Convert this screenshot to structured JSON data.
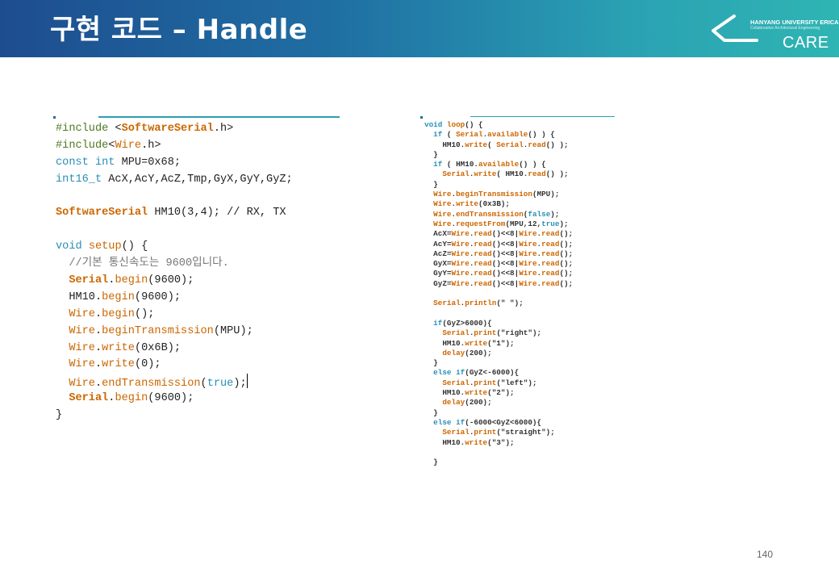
{
  "slide": {
    "title": "구현 코드 – Handle",
    "page_number": "140"
  },
  "logo": {
    "university": "HANYANG UNIVERSITY ERICA",
    "subtitle": "Collaborative Architectural Engineering",
    "brand": "CARE"
  },
  "left_code": {
    "lines": [
      [
        {
          "t": "#include ",
          "c": "pp"
        },
        {
          "t": "<",
          "c": ""
        },
        {
          "t": "SoftwareSerial",
          "c": "tyb"
        },
        {
          "t": ".h>",
          "c": ""
        }
      ],
      [
        {
          "t": "#include",
          "c": "pp"
        },
        {
          "t": "<",
          "c": ""
        },
        {
          "t": "Wire",
          "c": "ty"
        },
        {
          "t": ".h>",
          "c": ""
        }
      ],
      [
        {
          "t": "const",
          "c": "kw"
        },
        {
          "t": " ",
          "c": ""
        },
        {
          "t": "int",
          "c": "kw"
        },
        {
          "t": " MPU=0x68;",
          "c": ""
        }
      ],
      [
        {
          "t": "int16_t",
          "c": "kw"
        },
        {
          "t": " AcX,AcY,AcZ,Tmp,GyX,GyY,GyZ;",
          "c": ""
        }
      ],
      [],
      [
        {
          "t": "SoftwareSerial",
          "c": "tyb"
        },
        {
          "t": " HM10(3,4); // RX, TX",
          "c": ""
        }
      ],
      [],
      [
        {
          "t": "void",
          "c": "kw"
        },
        {
          "t": " ",
          "c": ""
        },
        {
          "t": "setup",
          "c": "ty"
        },
        {
          "t": "() {",
          "c": ""
        }
      ],
      [
        {
          "t": "  //기본 통신속도는 9600입니다.",
          "c": "cm"
        }
      ],
      [
        {
          "t": "  ",
          "c": ""
        },
        {
          "t": "Serial",
          "c": "tyb"
        },
        {
          "t": ".",
          "c": ""
        },
        {
          "t": "begin",
          "c": "fn"
        },
        {
          "t": "(9600);",
          "c": ""
        }
      ],
      [
        {
          "t": "  HM10.",
          "c": ""
        },
        {
          "t": "begin",
          "c": "fn"
        },
        {
          "t": "(9600);",
          "c": ""
        }
      ],
      [
        {
          "t": "  ",
          "c": ""
        },
        {
          "t": "Wire",
          "c": "ty"
        },
        {
          "t": ".",
          "c": ""
        },
        {
          "t": "begin",
          "c": "fn"
        },
        {
          "t": "();",
          "c": ""
        }
      ],
      [
        {
          "t": "  ",
          "c": ""
        },
        {
          "t": "Wire",
          "c": "ty"
        },
        {
          "t": ".",
          "c": ""
        },
        {
          "t": "beginTransmission",
          "c": "fn"
        },
        {
          "t": "(MPU);",
          "c": ""
        }
      ],
      [
        {
          "t": "  ",
          "c": ""
        },
        {
          "t": "Wire",
          "c": "ty"
        },
        {
          "t": ".",
          "c": ""
        },
        {
          "t": "write",
          "c": "fn"
        },
        {
          "t": "(0x6B);",
          "c": ""
        }
      ],
      [
        {
          "t": "  ",
          "c": ""
        },
        {
          "t": "Wire",
          "c": "ty"
        },
        {
          "t": ".",
          "c": ""
        },
        {
          "t": "write",
          "c": "fn"
        },
        {
          "t": "(0);",
          "c": ""
        }
      ],
      [
        {
          "t": "  ",
          "c": ""
        },
        {
          "t": "Wire",
          "c": "ty"
        },
        {
          "t": ".",
          "c": ""
        },
        {
          "t": "endTransmission",
          "c": "fn"
        },
        {
          "t": "(",
          "c": ""
        },
        {
          "t": "true",
          "c": "kw"
        },
        {
          "t": ");",
          "c": ""
        },
        {
          "t": "",
          "c": "cursor"
        }
      ],
      [
        {
          "t": "  ",
          "c": ""
        },
        {
          "t": "Serial",
          "c": "tyb"
        },
        {
          "t": ".",
          "c": ""
        },
        {
          "t": "begin",
          "c": "fn"
        },
        {
          "t": "(9600);",
          "c": ""
        }
      ],
      [
        {
          "t": "}",
          "c": ""
        }
      ]
    ]
  },
  "right_code": {
    "lines": [
      [
        {
          "t": "void",
          "c": "kw"
        },
        {
          "t": " ",
          "c": ""
        },
        {
          "t": "loop",
          "c": "ty"
        },
        {
          "t": "() {",
          "c": ""
        }
      ],
      [
        {
          "t": "  ",
          "c": ""
        },
        {
          "t": "if",
          "c": "kw"
        },
        {
          "t": " ( ",
          "c": ""
        },
        {
          "t": "Serial",
          "c": "ty"
        },
        {
          "t": ".",
          "c": ""
        },
        {
          "t": "available",
          "c": "fn"
        },
        {
          "t": "() ) {",
          "c": ""
        }
      ],
      [
        {
          "t": "    HM10.",
          "c": ""
        },
        {
          "t": "write",
          "c": "fn"
        },
        {
          "t": "( ",
          "c": ""
        },
        {
          "t": "Serial",
          "c": "ty"
        },
        {
          "t": ".",
          "c": ""
        },
        {
          "t": "read",
          "c": "fn"
        },
        {
          "t": "() );",
          "c": ""
        }
      ],
      [
        {
          "t": "  }",
          "c": ""
        }
      ],
      [
        {
          "t": "  ",
          "c": ""
        },
        {
          "t": "if",
          "c": "kw"
        },
        {
          "t": " ( HM10.",
          "c": ""
        },
        {
          "t": "available",
          "c": "fn"
        },
        {
          "t": "() ) {",
          "c": ""
        }
      ],
      [
        {
          "t": "    ",
          "c": ""
        },
        {
          "t": "Serial",
          "c": "ty"
        },
        {
          "t": ".",
          "c": ""
        },
        {
          "t": "write",
          "c": "fn"
        },
        {
          "t": "( HM10.",
          "c": ""
        },
        {
          "t": "read",
          "c": "fn"
        },
        {
          "t": "() );",
          "c": ""
        }
      ],
      [
        {
          "t": "  }",
          "c": ""
        }
      ],
      [
        {
          "t": "  ",
          "c": ""
        },
        {
          "t": "Wire",
          "c": "ty"
        },
        {
          "t": ".",
          "c": ""
        },
        {
          "t": "beginTransmission",
          "c": "fn"
        },
        {
          "t": "(MPU);",
          "c": ""
        }
      ],
      [
        {
          "t": "  ",
          "c": ""
        },
        {
          "t": "Wire",
          "c": "ty"
        },
        {
          "t": ".",
          "c": ""
        },
        {
          "t": "write",
          "c": "fn"
        },
        {
          "t": "(0x3B);",
          "c": ""
        }
      ],
      [
        {
          "t": "  ",
          "c": ""
        },
        {
          "t": "Wire",
          "c": "ty"
        },
        {
          "t": ".",
          "c": ""
        },
        {
          "t": "endTransmission",
          "c": "fn"
        },
        {
          "t": "(",
          "c": ""
        },
        {
          "t": "false",
          "c": "kw"
        },
        {
          "t": ");",
          "c": ""
        }
      ],
      [
        {
          "t": "  ",
          "c": ""
        },
        {
          "t": "Wire",
          "c": "ty"
        },
        {
          "t": ".",
          "c": ""
        },
        {
          "t": "requestFrom",
          "c": "fn"
        },
        {
          "t": "(MPU,12,",
          "c": ""
        },
        {
          "t": "true",
          "c": "kw"
        },
        {
          "t": ");",
          "c": ""
        }
      ],
      [
        {
          "t": "  AcX=",
          "c": ""
        },
        {
          "t": "Wire",
          "c": "ty"
        },
        {
          "t": ".",
          "c": ""
        },
        {
          "t": "read",
          "c": "fn"
        },
        {
          "t": "()<<8|",
          "c": ""
        },
        {
          "t": "Wire",
          "c": "ty"
        },
        {
          "t": ".",
          "c": ""
        },
        {
          "t": "read",
          "c": "fn"
        },
        {
          "t": "();",
          "c": ""
        }
      ],
      [
        {
          "t": "  AcY=",
          "c": ""
        },
        {
          "t": "Wire",
          "c": "ty"
        },
        {
          "t": ".",
          "c": ""
        },
        {
          "t": "read",
          "c": "fn"
        },
        {
          "t": "()<<8|",
          "c": ""
        },
        {
          "t": "Wire",
          "c": "ty"
        },
        {
          "t": ".",
          "c": ""
        },
        {
          "t": "read",
          "c": "fn"
        },
        {
          "t": "();",
          "c": ""
        }
      ],
      [
        {
          "t": "  AcZ=",
          "c": ""
        },
        {
          "t": "Wire",
          "c": "ty"
        },
        {
          "t": ".",
          "c": ""
        },
        {
          "t": "read",
          "c": "fn"
        },
        {
          "t": "()<<8|",
          "c": ""
        },
        {
          "t": "Wire",
          "c": "ty"
        },
        {
          "t": ".",
          "c": ""
        },
        {
          "t": "read",
          "c": "fn"
        },
        {
          "t": "();",
          "c": ""
        }
      ],
      [
        {
          "t": "  GyX=",
          "c": ""
        },
        {
          "t": "Wire",
          "c": "ty"
        },
        {
          "t": ".",
          "c": ""
        },
        {
          "t": "read",
          "c": "fn"
        },
        {
          "t": "()<<8|",
          "c": ""
        },
        {
          "t": "Wire",
          "c": "ty"
        },
        {
          "t": ".",
          "c": ""
        },
        {
          "t": "read",
          "c": "fn"
        },
        {
          "t": "();",
          "c": ""
        }
      ],
      [
        {
          "t": "  GyY=",
          "c": ""
        },
        {
          "t": "Wire",
          "c": "ty"
        },
        {
          "t": ".",
          "c": ""
        },
        {
          "t": "read",
          "c": "fn"
        },
        {
          "t": "()<<8|",
          "c": ""
        },
        {
          "t": "Wire",
          "c": "ty"
        },
        {
          "t": ".",
          "c": ""
        },
        {
          "t": "read",
          "c": "fn"
        },
        {
          "t": "();",
          "c": ""
        }
      ],
      [
        {
          "t": "  GyZ=",
          "c": ""
        },
        {
          "t": "Wire",
          "c": "ty"
        },
        {
          "t": ".",
          "c": ""
        },
        {
          "t": "read",
          "c": "fn"
        },
        {
          "t": "()<<8|",
          "c": ""
        },
        {
          "t": "Wire",
          "c": "ty"
        },
        {
          "t": ".",
          "c": ""
        },
        {
          "t": "read",
          "c": "fn"
        },
        {
          "t": "();",
          "c": ""
        }
      ],
      [],
      [
        {
          "t": "  ",
          "c": ""
        },
        {
          "t": "Serial",
          "c": "ty"
        },
        {
          "t": ".",
          "c": ""
        },
        {
          "t": "println",
          "c": "fn"
        },
        {
          "t": "(\" \");",
          "c": ""
        }
      ],
      [],
      [
        {
          "t": "  ",
          "c": ""
        },
        {
          "t": "if",
          "c": "kw"
        },
        {
          "t": "(GyZ>6000){",
          "c": ""
        }
      ],
      [
        {
          "t": "    ",
          "c": ""
        },
        {
          "t": "Serial",
          "c": "ty"
        },
        {
          "t": ".",
          "c": ""
        },
        {
          "t": "print",
          "c": "fn"
        },
        {
          "t": "(\"right\");",
          "c": ""
        }
      ],
      [
        {
          "t": "    HM10.",
          "c": ""
        },
        {
          "t": "write",
          "c": "fn"
        },
        {
          "t": "(\"1\");",
          "c": ""
        }
      ],
      [
        {
          "t": "    ",
          "c": ""
        },
        {
          "t": "delay",
          "c": "fn"
        },
        {
          "t": "(200);",
          "c": ""
        }
      ],
      [
        {
          "t": "  }",
          "c": ""
        }
      ],
      [
        {
          "t": "  ",
          "c": ""
        },
        {
          "t": "else if",
          "c": "kw"
        },
        {
          "t": "(GyZ<-6000){",
          "c": ""
        }
      ],
      [
        {
          "t": "    ",
          "c": ""
        },
        {
          "t": "Serial",
          "c": "ty"
        },
        {
          "t": ".",
          "c": ""
        },
        {
          "t": "print",
          "c": "fn"
        },
        {
          "t": "(\"left\");",
          "c": ""
        }
      ],
      [
        {
          "t": "    HM10.",
          "c": ""
        },
        {
          "t": "write",
          "c": "fn"
        },
        {
          "t": "(\"2\");",
          "c": ""
        }
      ],
      [
        {
          "t": "    ",
          "c": ""
        },
        {
          "t": "delay",
          "c": "fn"
        },
        {
          "t": "(200);",
          "c": ""
        }
      ],
      [
        {
          "t": "  }",
          "c": ""
        }
      ],
      [
        {
          "t": "  ",
          "c": ""
        },
        {
          "t": "else if",
          "c": "kw"
        },
        {
          "t": "(-6000<GyZ<6000){",
          "c": ""
        }
      ],
      [
        {
          "t": "    ",
          "c": ""
        },
        {
          "t": "Serial",
          "c": "ty"
        },
        {
          "t": ".",
          "c": ""
        },
        {
          "t": "print",
          "c": "fn"
        },
        {
          "t": "(\"straight\");",
          "c": ""
        }
      ],
      [
        {
          "t": "    HM10.",
          "c": ""
        },
        {
          "t": "write",
          "c": "fn"
        },
        {
          "t": "(\"3\");",
          "c": ""
        }
      ],
      [],
      [
        {
          "t": "  }",
          "c": ""
        }
      ]
    ]
  },
  "colors": {
    "header_start": "#1e4d8f",
    "header_end": "#2fb5b3",
    "keyword": "#2a8fb5",
    "type": "#cc6600",
    "preprocessor": "#4e7a20",
    "comment": "#777777"
  }
}
